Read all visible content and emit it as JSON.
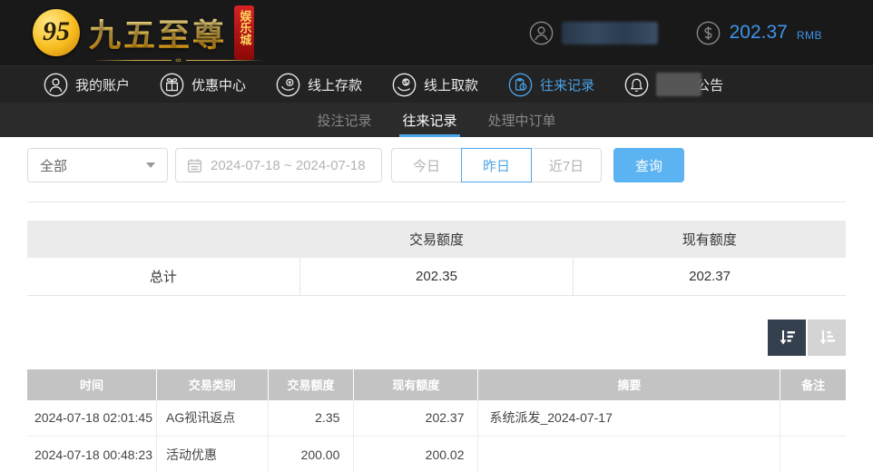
{
  "header": {
    "logo": {
      "monogram": "95",
      "title": "九五至尊",
      "badge": "娱乐城"
    },
    "balance": {
      "amount": "202.37",
      "currency": "RMB"
    }
  },
  "nav": {
    "items": [
      {
        "label": "我的账户",
        "icon": "user-icon",
        "active": false
      },
      {
        "label": "优惠中心",
        "icon": "gift-icon",
        "active": false
      },
      {
        "label": "线上存款",
        "icon": "deposit-icon",
        "active": false
      },
      {
        "label": "线上取款",
        "icon": "withdraw-icon",
        "active": false
      },
      {
        "label": "往来记录",
        "icon": "records-icon",
        "active": true
      },
      {
        "label": "公告",
        "icon": "bell-icon",
        "active": false,
        "redacted_prefix": true
      }
    ]
  },
  "subtabs": [
    {
      "label": "投注记录",
      "active": false
    },
    {
      "label": "往来记录",
      "active": true
    },
    {
      "label": "处理中订单",
      "active": false
    }
  ],
  "filters": {
    "type_select": {
      "value": "全部"
    },
    "date_range": {
      "value": "2024-07-18 ~ 2024-07-18"
    },
    "quick_buttons": [
      {
        "label": "今日",
        "active": false
      },
      {
        "label": "昨日",
        "active": true
      },
      {
        "label": "近7日",
        "active": false
      }
    ],
    "search_label": "查询"
  },
  "summary_table": {
    "headers": [
      "",
      "交易额度",
      "现有额度"
    ],
    "total_label": "总计",
    "trade_amount": "202.35",
    "current_amount": "202.37"
  },
  "records_table": {
    "headers": [
      "时间",
      "交易类别",
      "交易额度",
      "现有额度",
      "摘要",
      "备注"
    ],
    "rows": [
      {
        "time": "2024-07-18 02:01:45",
        "type": "AG视讯返点",
        "amount": "2.35",
        "balance": "202.37",
        "summary": "系统派发_2024-07-17",
        "note": ""
      },
      {
        "time": "2024-07-18 00:48:23",
        "type": "活动优惠",
        "amount": "200.00",
        "balance": "200.02",
        "summary": "",
        "note": ""
      }
    ]
  },
  "colors": {
    "accent_blue": "#4aa0e4",
    "button_blue": "#5cb3f1",
    "balance_blue": "#3f93e8",
    "logo_gold": "#f3a912",
    "badge_red": "#a50d0d",
    "table_header_gray": "#c3c3c3",
    "sort_active_bg": "#35404f"
  }
}
